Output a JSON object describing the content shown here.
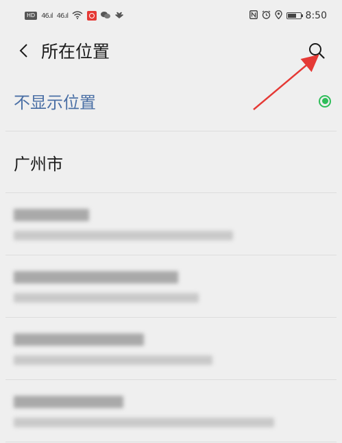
{
  "status_bar": {
    "left_badge": "HD",
    "signal_1": "46.ıl",
    "signal_2": "46.ıl",
    "time": "8:50",
    "icons": [
      "hd-icon",
      "signal-icon",
      "signal-icon",
      "wifi-icon",
      "app-notification-icon",
      "wechat-icon",
      "huawei-icon",
      "nfc-icon",
      "alarm-icon",
      "location-icon",
      "battery-icon"
    ]
  },
  "nav": {
    "title": "所在位置",
    "back_icon": "chevron-left-icon",
    "search_icon": "search-icon"
  },
  "list": {
    "hide_location": {
      "label": "不显示位置",
      "selected": true
    },
    "city": {
      "label": "广州市"
    }
  },
  "colors": {
    "background": "#efefef",
    "hide_label": "#4a6fa5",
    "radio_selected": "#2ebd59",
    "annotation_arrow": "#e53935"
  }
}
